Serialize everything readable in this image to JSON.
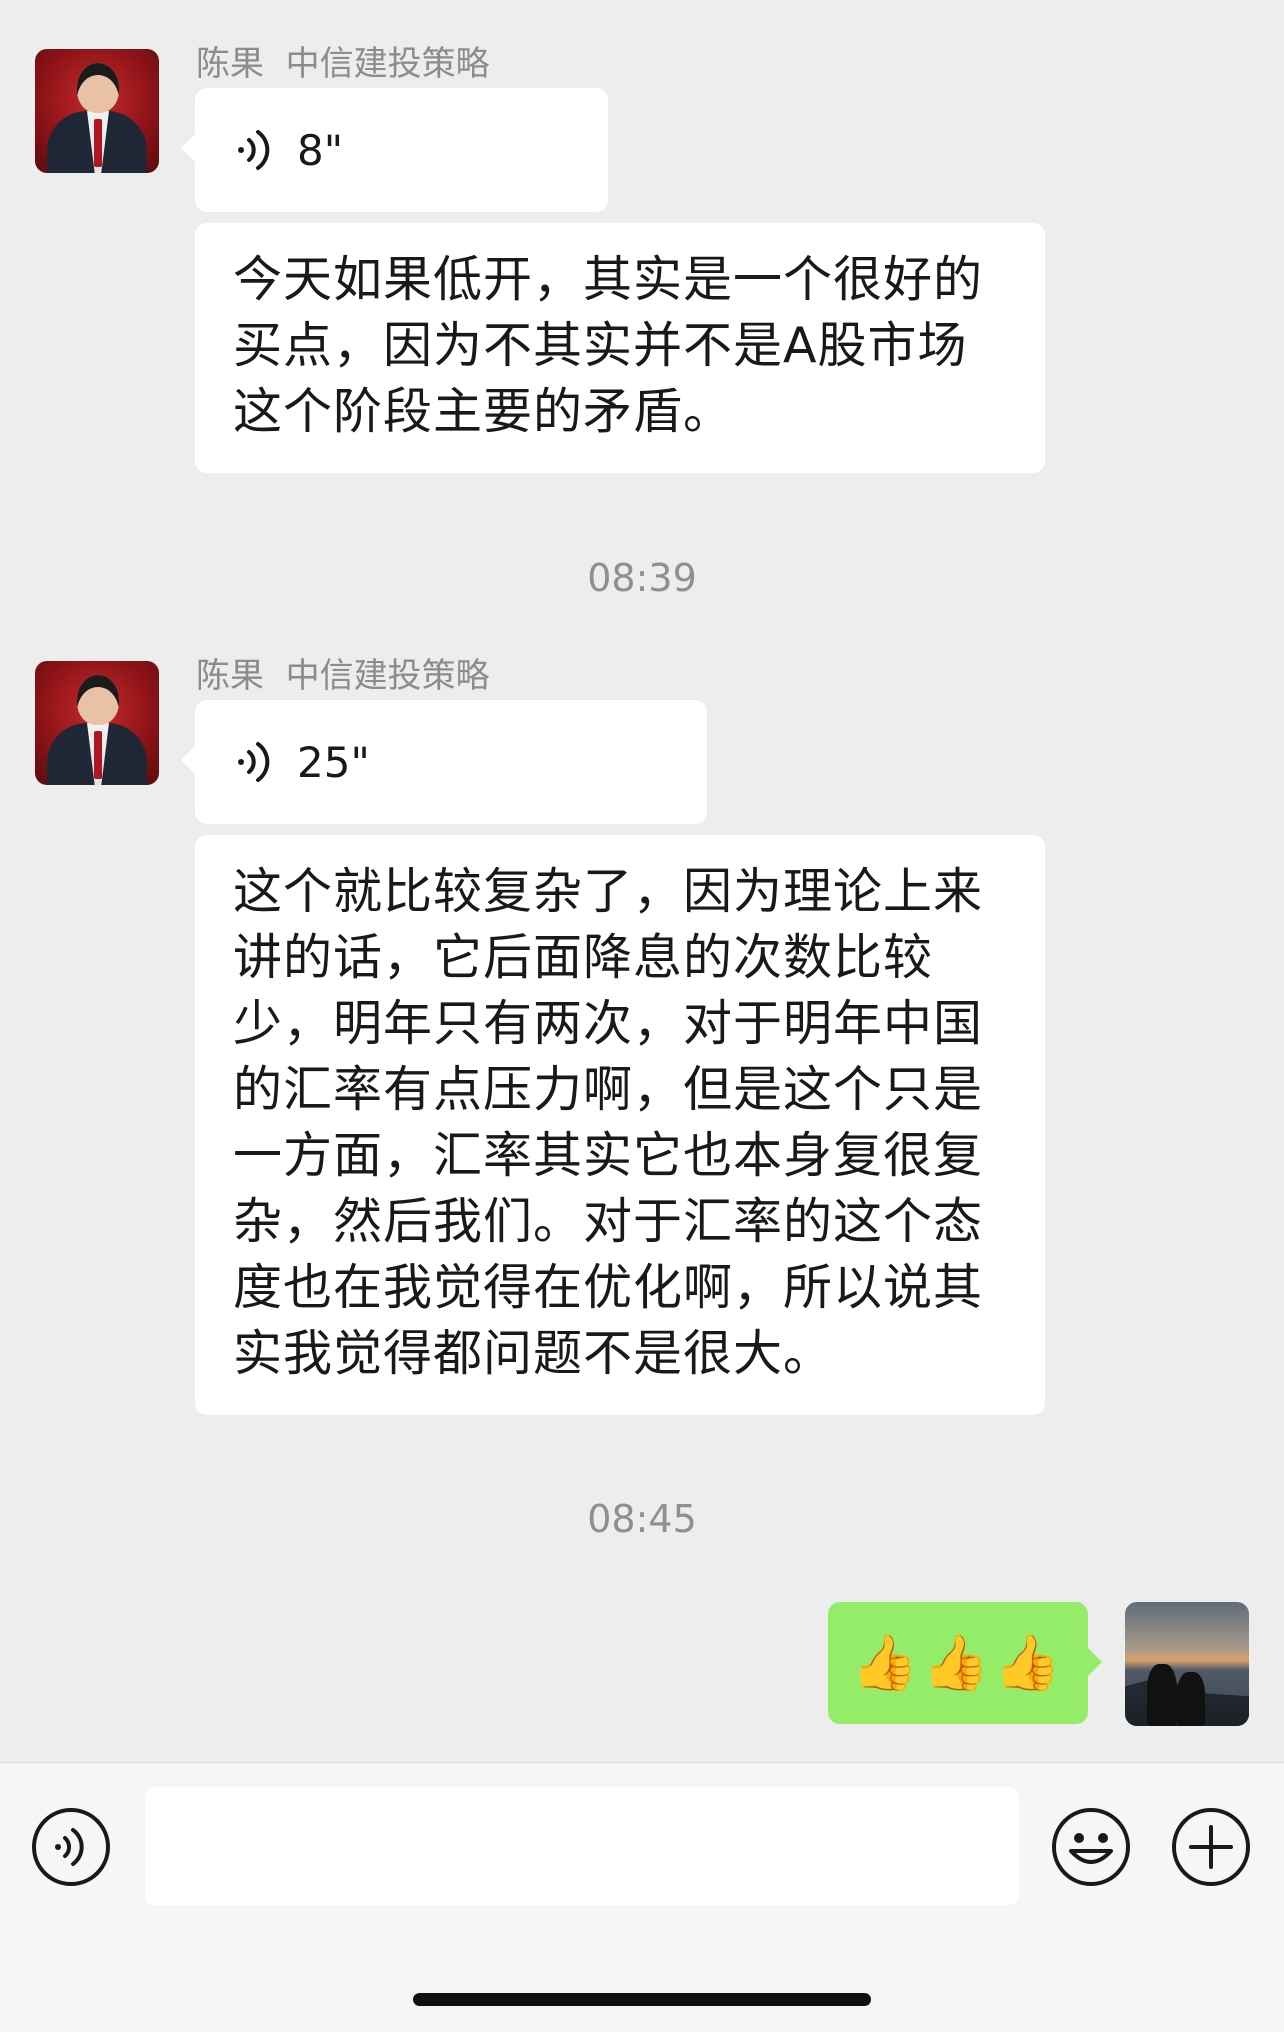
{
  "messages": [
    {
      "sender": "陈果  中信建投策略",
      "voice_duration": "8\"",
      "text": "今天如果低开，其实是一个很好的买点，因为不其实并不是A股市场这个阶段主要的矛盾。"
    },
    {
      "timestamp": "08:39",
      "sender": "陈果  中信建投策略",
      "voice_duration": "25\"",
      "text": "这个就比较复杂了，因为理论上来讲的话，它后面降息的次数比较少，明年只有两次，对于明年中国的汇率有点压力啊，但是这个只是一方面，汇率其实它也本身复很复杂，然后我们。对于汇率的这个态度也在我觉得在优化啊，所以说其实我觉得都问题不是很大。"
    },
    {
      "timestamp": "08:45",
      "my_message": "👍👍👍"
    }
  ],
  "input_bar": {
    "placeholder": "",
    "icons": [
      "voice-icon",
      "emoji-icon",
      "plus-icon"
    ]
  },
  "colors": {
    "background": "#ededed",
    "my_bubble": "#95ec69",
    "other_bubble": "#ffffff",
    "meta_text": "#8c8c8c"
  }
}
